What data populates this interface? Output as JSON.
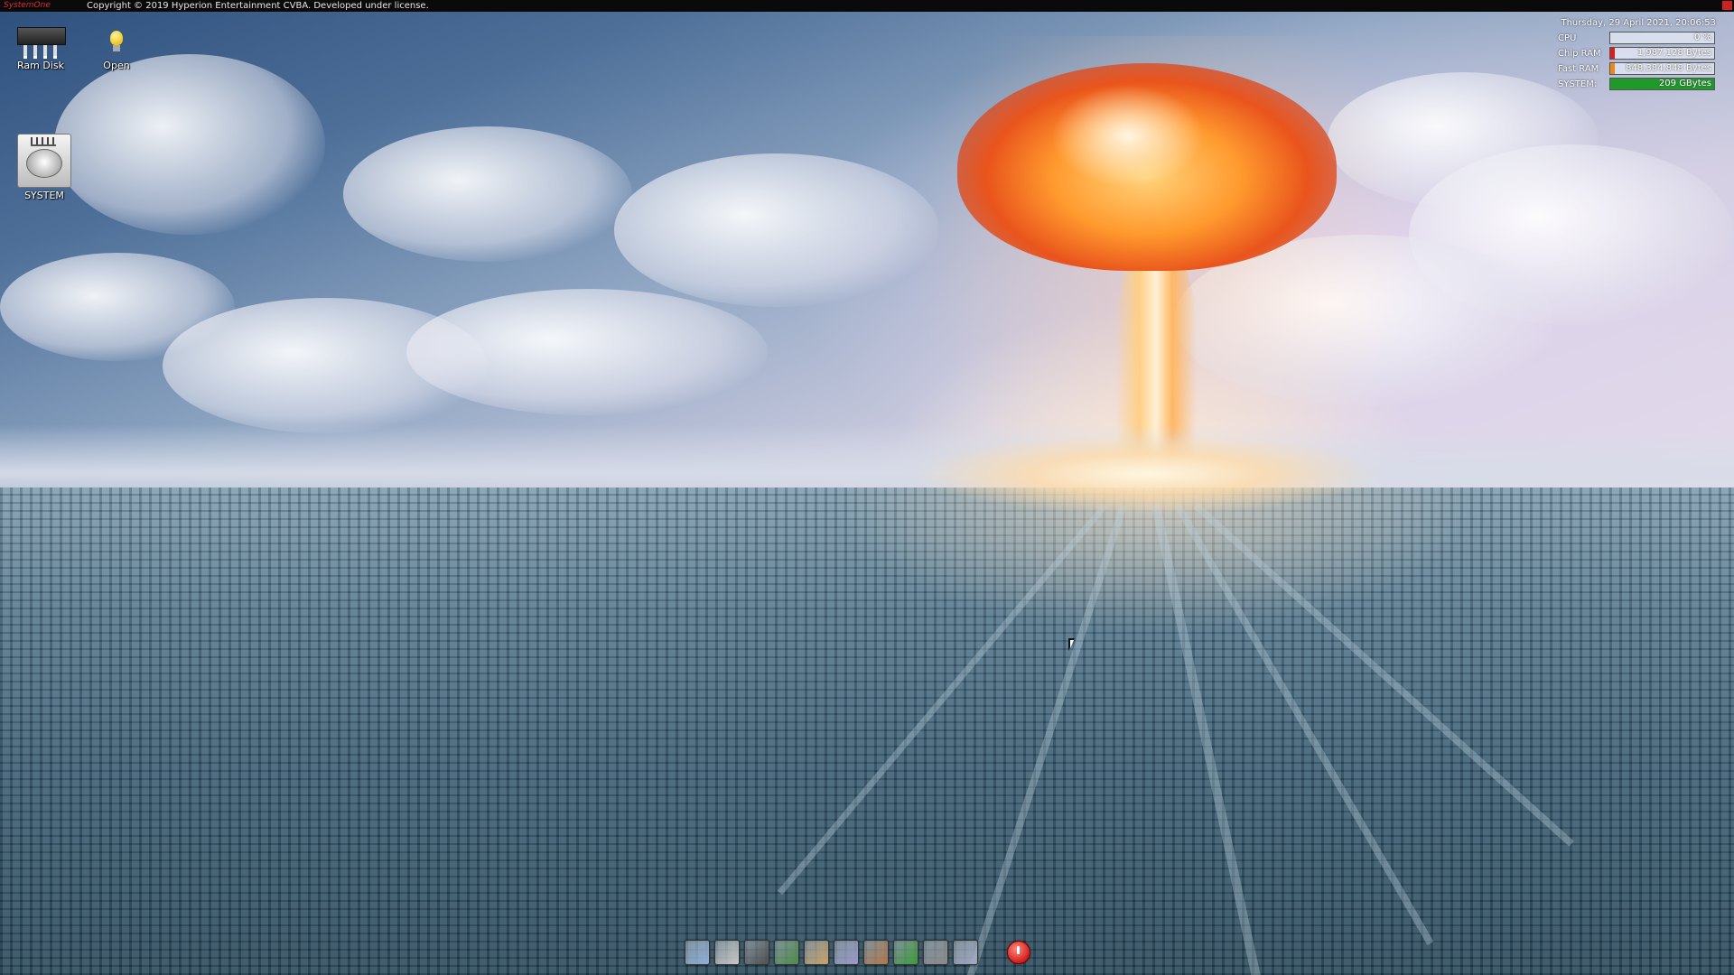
{
  "menubar": {
    "brand": "SystemOne",
    "copyright": "Copyright © 2019 Hyperion Entertainment CVBA. Developed under license."
  },
  "desktop_icons": [
    {
      "label": "Ram Disk",
      "icon": "ram-disk-icon"
    },
    {
      "label": "Open",
      "icon": "light-bulb-icon"
    },
    {
      "label": "SYSTEM",
      "icon": "hard-drive-icon"
    }
  ],
  "monitor": {
    "datetime": "Thursday, 29 April 2021, 20:06:53",
    "rows": [
      {
        "name": "CPU",
        "value": "0 %",
        "fraction": 0.0,
        "color": "#3a8f3a"
      },
      {
        "name": "Chip RAM",
        "value": "1,987,128 Bytes",
        "fraction": 0.04,
        "color": "#d42020"
      },
      {
        "name": "Fast RAM",
        "value": "848,384,848 Bytes",
        "fraction": 0.04,
        "color": "#e88a1a"
      },
      {
        "name": "SYSTEM:",
        "value": "209 GBytes",
        "fraction": 1.0,
        "color": "#1e9a2a"
      }
    ]
  },
  "dock": {
    "items": [
      {
        "icon": "window-icon",
        "color": "#8fb0d8"
      },
      {
        "icon": "list-window-icon",
        "color": "#c8c8c8"
      },
      {
        "icon": "monitor-icon",
        "color": "#505050"
      },
      {
        "icon": "notepad-icon",
        "color": "#4f8c4a"
      },
      {
        "icon": "paint-icon",
        "color": "#c9a26a"
      },
      {
        "icon": "color-picker-icon",
        "color": "#9a9ac8"
      },
      {
        "icon": "tools-icon",
        "color": "#b0784a"
      },
      {
        "icon": "spreadsheet-icon",
        "color": "#3f9a3a"
      },
      {
        "icon": "drive-icon",
        "color": "#8a8a8a"
      },
      {
        "icon": "document-icon",
        "color": "#a0a8c0"
      },
      {
        "icon": "shutdown-icon",
        "color": "#d01e1e"
      }
    ]
  },
  "colors": {
    "menubar_bg": "#0a0a0a",
    "brand": "#e02a2a"
  }
}
